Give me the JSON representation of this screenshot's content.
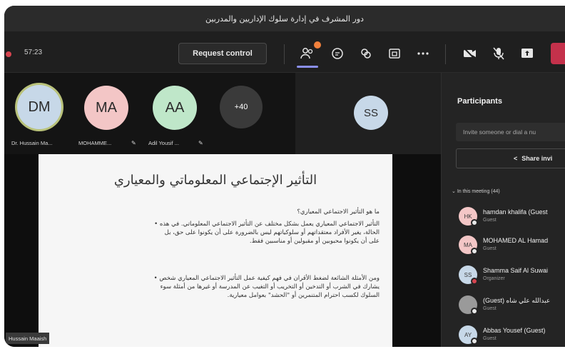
{
  "window": {
    "title": "دور المشرف في إدارة سلوك الإداريين والمدربين"
  },
  "toolbar": {
    "timer": "57:23",
    "request_control_label": "Request control",
    "icons": [
      "people-icon",
      "chat-icon",
      "reactions-icon",
      "view-icon",
      "more-icon",
      "camera-off-icon",
      "mic-off-icon",
      "share-icon",
      "leave-icon"
    ]
  },
  "gallery": {
    "tiles": [
      {
        "initials": "DM",
        "name": "Dr. Hussain Ma...",
        "color": "#c7d8e8",
        "ring": "#b9c27a"
      },
      {
        "initials": "MA",
        "name": "MOHAMME...",
        "color": "#f3c6c6"
      },
      {
        "initials": "AA",
        "name": "Adil Yousif ...",
        "color": "#bfe7c9"
      },
      {
        "initials": "+40",
        "color": "#3a3a3a"
      }
    ],
    "spotlight_initials": "SS"
  },
  "slide": {
    "title": "التأثير الإجتماعي المعلوماتي والمعياري",
    "question": "ما هو التأثير الاجتماعي المعياري؟",
    "bullet1_lines": [
      "التأثير الاجتماعي المعياري يعمل بشكل مختلف عن التأثير الاجتماعي المعلوماتي. في هذه •",
      "الحالة، يغير الأفراد معتقداتهم أو سلوكياتهم ليس بالضرورة على أن يكونوا على حق، بل",
      "على أن يكونوا محبوبين أو مقبولين أو مناسبين فقط."
    ],
    "bullet2_lines": [
      "ومن الأمثلة الشائعة لضغط الأقران في فهم كيفية عمل التأثير الاجتماعي المعياري شخص •",
      "يشارك في الشرب أو التدخين أو التخريب أو التغيب عن المدرسة أو غيرها من أمثلة سوء",
      "السلوك لكسب احترام المتنمرين أو \"الحشد\" بعوامل معيارية."
    ]
  },
  "presenter_tag": "Hussain Maaish",
  "panel": {
    "title": "Participants",
    "invite_placeholder": "Invite someone or dial a nu",
    "share_label": "Share invi",
    "meeting_header": "In this meeting (44)",
    "participants": [
      {
        "initials": "HK",
        "name": "hamdan khalifa (Guest",
        "role": "Guest",
        "color": "#f3c6c6"
      },
      {
        "initials": "MA",
        "name": "MOHAMED AL Hamad",
        "role": "Guest",
        "color": "#f3c6c6"
      },
      {
        "initials": "SS",
        "name": "Shamma Saif Al Suwai",
        "role": "Organizer",
        "color": "#c7d8e8"
      },
      {
        "initials": "",
        "name": "(Guest) عبدالله علي شاه",
        "role": "Guest",
        "color": "#9a9a9a"
      },
      {
        "initials": "AY",
        "name": "Abbas Yousef (Guest)",
        "role": "Guest",
        "color": "#c7d8e8"
      }
    ]
  }
}
